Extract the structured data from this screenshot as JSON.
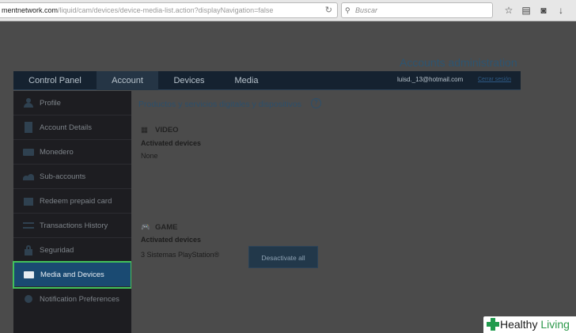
{
  "browser": {
    "url_host": "mentnetwork.com",
    "url_path": "/liquid/cam/devices/device-media-list.action?displayNavigation=false",
    "search_placeholder": "Buscar",
    "reload_glyph": "↻",
    "search_glyph": "⚲",
    "toolbar_icons": [
      {
        "name": "star-icon",
        "glyph": "☆"
      },
      {
        "name": "clipboard-icon",
        "glyph": "▤"
      },
      {
        "name": "pocket-icon",
        "glyph": "◙"
      },
      {
        "name": "download-icon",
        "glyph": "↓"
      },
      {
        "name": "home-icon",
        "glyph": "⌂"
      },
      {
        "name": "menu-icon",
        "glyph": "≡"
      }
    ]
  },
  "header": {
    "title": "Accounts administration",
    "user_email": "luisd._13@hotmail.com",
    "logout": "Cerrar sesión"
  },
  "topnav": {
    "tabs": [
      {
        "label": "Control Panel",
        "active": false
      },
      {
        "label": "Account",
        "active": true
      },
      {
        "label": "Devices",
        "active": false
      },
      {
        "label": "Media",
        "active": false
      }
    ]
  },
  "sidebar": {
    "items": [
      {
        "label": "Profile",
        "icon": "user-icon"
      },
      {
        "label": "Account Details",
        "icon": "document-icon"
      },
      {
        "label": "Monedero",
        "icon": "wallet-icon"
      },
      {
        "label": "Sub-accounts",
        "icon": "users-icon"
      },
      {
        "label": "Redeem prepaid card",
        "icon": "gift-icon"
      },
      {
        "label": "Transactions History",
        "icon": "transfer-icon"
      },
      {
        "label": "Seguridad",
        "icon": "lock-icon"
      },
      {
        "label": "Media and Devices",
        "icon": "media-devices-icon",
        "active": true
      },
      {
        "label": "Notification Preferences",
        "icon": "notification-icon"
      }
    ]
  },
  "content": {
    "title": "Productos y servicios digitales y dispositivos",
    "help_glyph": "?",
    "video": {
      "heading": "VIDEO",
      "icon_glyph": "▦",
      "activated_label": "Activated devices",
      "activated_value": "None"
    },
    "game": {
      "heading": "GAME",
      "icon_glyph": "🎮",
      "activated_label": "Activated devices",
      "activated_value": "3 Sistemas PlayStation®",
      "button": "Desactivate all"
    }
  },
  "watermark": {
    "word1": "Healthy",
    "word2": "Living"
  },
  "colors": {
    "active_item": "#1a4a72",
    "highlight_outline": "#43c25a",
    "nav_bg": "#152230",
    "brand_green": "#2e9a4c"
  }
}
